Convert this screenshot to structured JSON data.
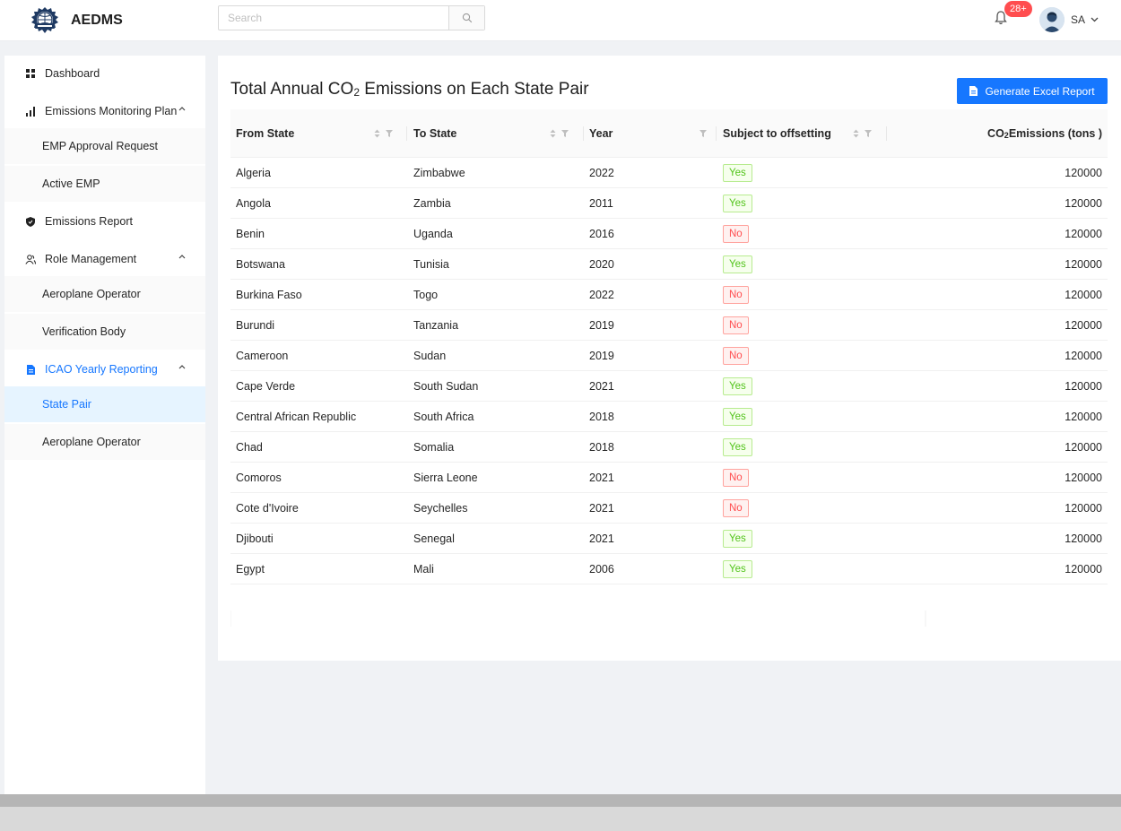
{
  "app": {
    "name": "AEDMS"
  },
  "header": {
    "search_placeholder": "Search",
    "notification_count": "28+",
    "user_initials": "SA"
  },
  "sidebar": {
    "items": [
      {
        "label": "Dashboard",
        "icon": "grid-icon"
      },
      {
        "label": "Emissions Monitoring Plan",
        "icon": "bar-chart-icon",
        "expanded": true,
        "children": [
          {
            "label": "EMP Approval Request"
          },
          {
            "label": "Active EMP"
          }
        ]
      },
      {
        "label": "Emissions Report",
        "icon": "shield-icon"
      },
      {
        "label": "Role Management",
        "icon": "users-icon",
        "expanded": true,
        "children": [
          {
            "label": "Aeroplane Operator"
          },
          {
            "label": "Verification Body"
          }
        ]
      },
      {
        "label": "ICAO Yearly Reporting",
        "icon": "file-icon",
        "expanded": true,
        "active": true,
        "children": [
          {
            "label": "State Pair",
            "active": true
          },
          {
            "label": "Aeroplane Operator"
          }
        ]
      }
    ]
  },
  "page": {
    "title_prefix": "Total Annual CO",
    "title_sub": "2",
    "title_suffix": " Emissions on Each State Pair",
    "generate_button": "Generate Excel Report"
  },
  "table": {
    "columns": {
      "from": "From State",
      "to": "To State",
      "year": "Year",
      "offset": "Subject to offsetting",
      "emissions_prefix": "CO",
      "emissions_sub": "2",
      "emissions_suffix": " Emissions (tons )"
    },
    "rows": [
      {
        "from": "Algeria",
        "to": "Zimbabwe",
        "year": "2022",
        "offset": "Yes",
        "emissions": "120000"
      },
      {
        "from": "Angola",
        "to": "Zambia",
        "year": "2011",
        "offset": "Yes",
        "emissions": "120000"
      },
      {
        "from": "Benin",
        "to": "Uganda",
        "year": "2016",
        "offset": "No",
        "emissions": "120000"
      },
      {
        "from": "Botswana",
        "to": "Tunisia",
        "year": "2020",
        "offset": "Yes",
        "emissions": "120000"
      },
      {
        "from": "Burkina Faso",
        "to": "Togo",
        "year": "2022",
        "offset": "No",
        "emissions": "120000"
      },
      {
        "from": "Burundi",
        "to": "Tanzania",
        "year": "2019",
        "offset": "No",
        "emissions": "120000"
      },
      {
        "from": "Cameroon",
        "to": "Sudan",
        "year": "2019",
        "offset": "No",
        "emissions": "120000"
      },
      {
        "from": "Cape Verde",
        "to": "South Sudan",
        "year": "2021",
        "offset": "Yes",
        "emissions": "120000"
      },
      {
        "from": "Central African Republic",
        "to": "South Africa",
        "year": "2018",
        "offset": "Yes",
        "emissions": "120000"
      },
      {
        "from": "Chad",
        "to": "Somalia",
        "year": "2018",
        "offset": "Yes",
        "emissions": "120000"
      },
      {
        "from": "Comoros",
        "to": "Sierra Leone",
        "year": "2021",
        "offset": "No",
        "emissions": "120000"
      },
      {
        "from": "Cote d'Ivoire",
        "to": "Seychelles",
        "year": "2021",
        "offset": "No",
        "emissions": "120000"
      },
      {
        "from": "Djibouti",
        "to": "Senegal",
        "year": "2021",
        "offset": "Yes",
        "emissions": "120000"
      },
      {
        "from": "Egypt",
        "to": "Mali",
        "year": "2006",
        "offset": "Yes",
        "emissions": "120000"
      }
    ]
  },
  "colors": {
    "primary": "#1677ff",
    "yes": "#52c41a",
    "no": "#ff4d4f",
    "badge": "#ff4d4f"
  }
}
